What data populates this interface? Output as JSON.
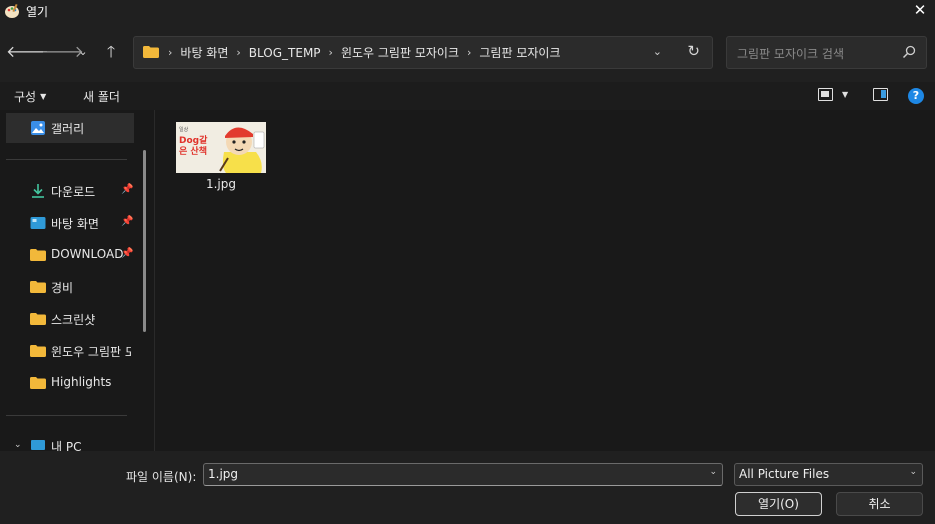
{
  "window": {
    "title": "열기",
    "app_icon": "paint-palette-icon",
    "close_icon": "close-icon"
  },
  "nav": {
    "back_icon": "arrow-left-icon",
    "forward_icon": "arrow-right-icon",
    "recent_icon": "chevron-down-icon",
    "up_icon": "arrow-up-icon",
    "breadcrumbs": [
      "바탕 화면",
      "BLOG_TEMP",
      "윈도우 그림판 모자이크",
      "그림판 모자이크"
    ],
    "refresh_icon": "refresh-icon",
    "search_placeholder": "그림판 모자이크 검색"
  },
  "commandbar": {
    "organize_label": "구성",
    "new_folder_label": "새 폴더",
    "view_icon": "view-mode-icon",
    "preview_pane_icon": "preview-pane-icon",
    "help_label": "?"
  },
  "sidebar": {
    "items": [
      {
        "label": "갤러리",
        "icon": "gallery-icon",
        "pinned": false,
        "selected": true
      },
      {
        "label": "다운로드",
        "icon": "download-icon",
        "pinned": true
      },
      {
        "label": "바탕 화면",
        "icon": "desktop-icon",
        "pinned": true
      },
      {
        "label": "DOWNLOADS",
        "icon": "folder-icon",
        "pinned": true
      },
      {
        "label": "경비",
        "icon": "folder-icon",
        "pinned": false
      },
      {
        "label": "스크린샷",
        "icon": "folder-icon",
        "pinned": false
      },
      {
        "label": "윈도우 그림판 모자이크",
        "icon": "folder-icon",
        "pinned": false
      },
      {
        "label": "Highlights",
        "icon": "folder-icon",
        "pinned": false
      },
      {
        "label": "내 PC",
        "icon": "pc-icon",
        "pinned": false
      }
    ]
  },
  "files": [
    {
      "name": "1.jpg",
      "thumb_text": "Dog같은 산책",
      "thumb_small": "일상"
    }
  ],
  "bottom": {
    "filename_label": "파일 이름(N):",
    "filename_value": "1.jpg",
    "filetype_value": "All Picture Files",
    "open_label": "열기(O)",
    "cancel_label": "취소"
  }
}
